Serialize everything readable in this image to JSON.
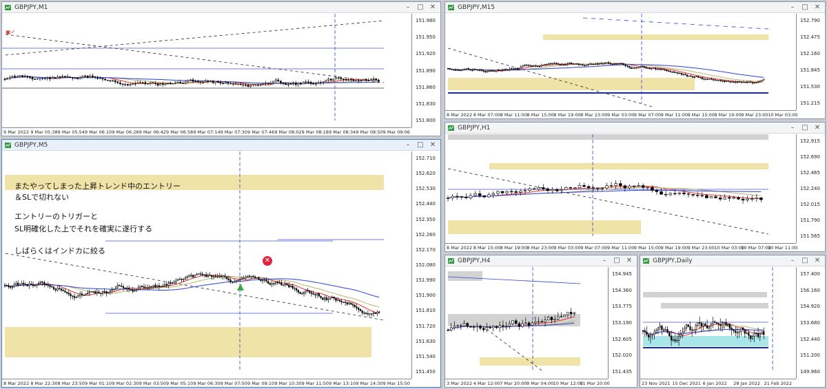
{
  "windows": {
    "m1": {
      "title": "GBPJPY,M1",
      "prices": [
        "151.980",
        "151.950",
        "151.920",
        "151.890",
        "151.860",
        "151.830",
        "151.800"
      ],
      "times": [
        "9 Mar 2022",
        "9 Mar 05:38",
        "9 Mar 05:54",
        "9 Mar 06:10",
        "9 Mar 06:26",
        "9 Mar 06:42",
        "9 Mar 06:58",
        "9 Mar 07:14",
        "9 Mar 07:30",
        "9 Mar 07:46",
        "9 Mar 08:02",
        "9 Mar 08:18",
        "9 Mar 08:34",
        "9 Mar 08:50",
        "9 Mar 09:06"
      ]
    },
    "m5": {
      "title": "GBPJPY,M5",
      "prices": [
        "152.710",
        "152.620",
        "152.530",
        "152.440",
        "152.350",
        "152.260",
        "152.170",
        "152.080",
        "151.990",
        "151.900",
        "151.810",
        "151.720",
        "151.630",
        "151.540",
        "151.450"
      ],
      "times": [
        "8 Mar 2022",
        "8 Mar 22:30",
        "8 Mar 23:50",
        "9 Mar 01:10",
        "9 Mar 02:30",
        "9 Mar 03:50",
        "9 Mar 05:10",
        "9 Mar 06:30",
        "9 Mar 07:50",
        "9 Mar 09:10",
        "9 Mar 10:30",
        "9 Mar 11:50",
        "9 Mar 13:10",
        "9 Mar 14:30",
        "9 Mar 15:50"
      ],
      "notes": {
        "line1": "またやってしまった上昇トレンド中のエントリー",
        "line2": "＆SLで切れない",
        "line3": "エントリーのトリガーと",
        "line4": "SL明確化した上でそれを確実に遂行する",
        "line5": "しばらくはインドカに絞る"
      }
    },
    "m15": {
      "title": "GBPJPY,M15",
      "prices": [
        "152.790",
        "152.475",
        "152.160",
        "151.845",
        "151.530",
        "151.215"
      ],
      "times": [
        "8 Mar 2022",
        "8 Mar 07:00",
        "8 Mar 11:00",
        "8 Mar 15:00",
        "8 Mar 19:00",
        "8 Mar 23:00",
        "9 Mar 03:00",
        "9 Mar 07:00",
        "9 Mar 11:00",
        "9 Mar 15:00",
        "9 Mar 19:00",
        "9 Mar 23:00",
        "10 Mar 03:00"
      ]
    },
    "h1": {
      "title": "GBPJPY,H1",
      "prices": [
        "152.915",
        "152.690",
        "152.465",
        "152.240",
        "152.015",
        "151.790",
        "151.565"
      ],
      "times": [
        "8 Mar 2022",
        "8 Mar 15:00",
        "8 Mar 19:00",
        "8 Mar 23:00",
        "9 Mar 03:00",
        "9 Mar 07:00",
        "9 Mar 11:00",
        "9 Mar 15:00",
        "9 Mar 19:00",
        "9 Mar 23:00",
        "10 Mar 03:00",
        "10 Mar 07:00",
        "10 Mar 11:00"
      ]
    },
    "h4": {
      "title": "GBPJPY,H4",
      "prices": [
        "154.945",
        "154.360",
        "153.775",
        "153.190",
        "152.605",
        "152.020",
        "151.435"
      ],
      "times": [
        "3 Mar 2022",
        "4 Mar 12:00",
        "7 Mar 20:00",
        "9 Mar 04:00",
        "10 Mar 12:00",
        "11 Mar 20:00"
      ]
    },
    "daily": {
      "title": "GBPJPY,Daily",
      "prices": [
        "157.400",
        "156.160",
        "154.920",
        "153.680",
        "152.440",
        "151.200",
        "149.960"
      ],
      "times": [
        "23 Nov 2021",
        "15 Dec 2021",
        "6 Jan 2022",
        "28 Jan 2022",
        "21 Feb 2022"
      ]
    }
  },
  "icons": {
    "minimize": "minimize-icon",
    "maximize": "maximize-icon",
    "close": "close-icon"
  },
  "colors": {
    "bull": "#ffffff",
    "bear": "#000000",
    "zone": "#efe3a8",
    "gray_zone": "#d2d2d2",
    "cyan_zone": "#a8e6ea",
    "sma_red": "#e8312a",
    "sma_blue": "#2b3fd6",
    "sma_olive": "#b9b36a"
  }
}
